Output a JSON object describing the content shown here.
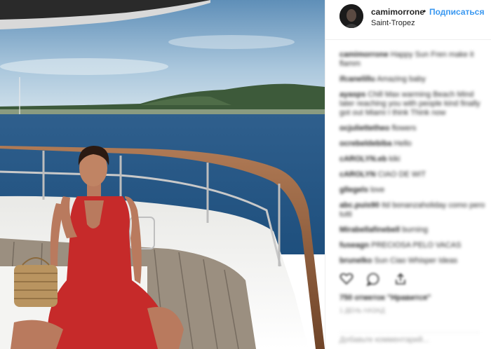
{
  "header": {
    "username": "camimorrone",
    "separator": "•",
    "follow_label": "Подписаться",
    "location": "Saint-Tropez"
  },
  "comments": [
    {
      "user": "camimorrone",
      "text": "Happy Sun Fren make it flamm"
    },
    {
      "user": "ifcanelillu",
      "text": "Amazing baby"
    },
    {
      "user": "ayasps",
      "text": "Chill Max warming Beach Mind later reaching you with people kind finally got out Miami I think Think now"
    },
    {
      "user": "ocjuliettetheo",
      "text": "flowers"
    },
    {
      "user": "ocrebeldebiba",
      "text": "Hello"
    },
    {
      "user": "cAROLYN.eb",
      "text": "kiki"
    },
    {
      "user": "cAROLYN",
      "text": "CIAO DE WIT"
    },
    {
      "user": "gllegels",
      "text": "love"
    },
    {
      "user": "abc.puis90",
      "text": "Itd bonanzaholiday como pero tutti"
    },
    {
      "user": "Mirabellafinebell",
      "text": "burning"
    },
    {
      "user": "fuseagn",
      "text": "PRECIOSA PELO VACAS"
    },
    {
      "user": "brunelko",
      "text": "Sun Ciao Whisper Ideas"
    }
  ],
  "likes_text": "750 отметок \"Нравится\"",
  "date_text": "1 ДЕНЬ НАЗАД",
  "add_comment_placeholder": "Добавьте комментарий...",
  "icons": [
    "heart-icon",
    "comment-icon",
    "share-icon"
  ]
}
